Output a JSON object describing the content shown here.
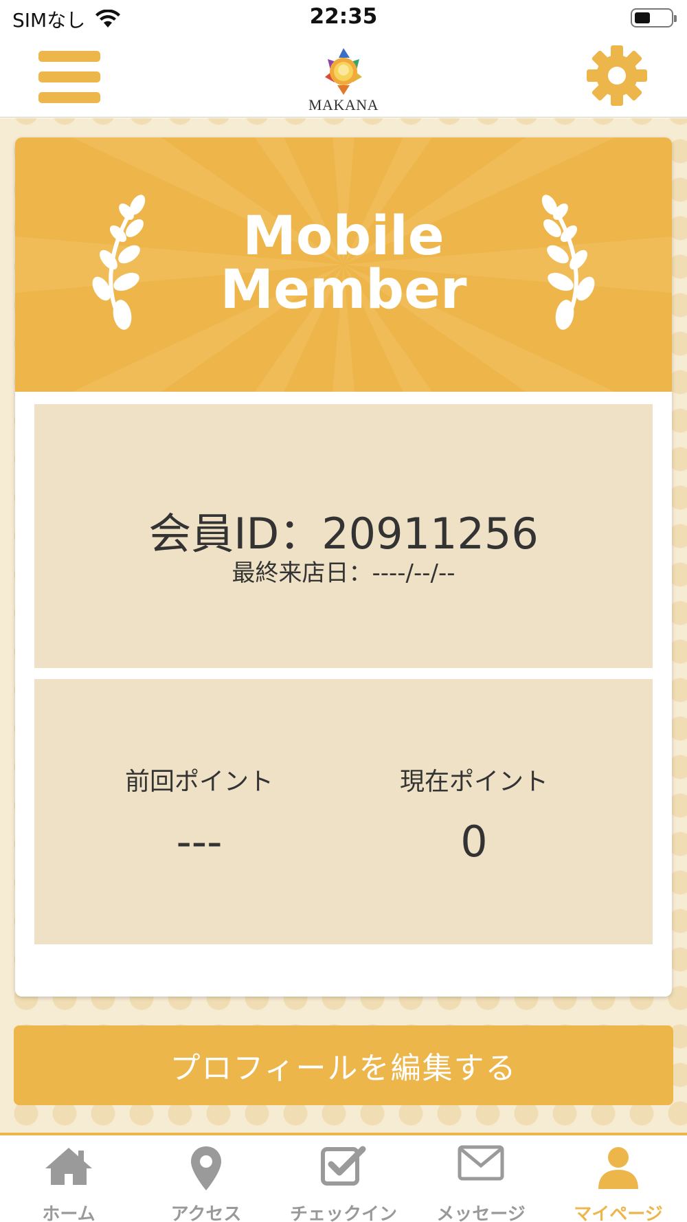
{
  "status_bar": {
    "carrier": "SIMなし",
    "time": "22:35"
  },
  "header": {
    "logo_text": "MAKANA"
  },
  "member_card": {
    "title_line1": "Mobile",
    "title_line2": "Member",
    "member_id": "会員ID：20911256",
    "last_visit": "最終来店日：----/--/--",
    "previous_points_label": "前回ポイント",
    "previous_points_value": "---",
    "current_points_label": "現在ポイント",
    "current_points_value": "0"
  },
  "edit_profile_label": "プロフィールを編集する",
  "tab_bar": {
    "items": [
      {
        "label": "ホーム",
        "icon": "home-icon"
      },
      {
        "label": "アクセス",
        "icon": "location-pin-icon"
      },
      {
        "label": "チェックイン",
        "icon": "checkbox-icon"
      },
      {
        "label": "メッセージ",
        "icon": "envelope-icon"
      },
      {
        "label": "マイページ",
        "icon": "user-icon"
      }
    ],
    "active_index": 4
  },
  "colors": {
    "accent": "#ecb64b",
    "panel": "#efe1c5",
    "background": "#f6ebd3",
    "inactive_tab": "#999999"
  }
}
